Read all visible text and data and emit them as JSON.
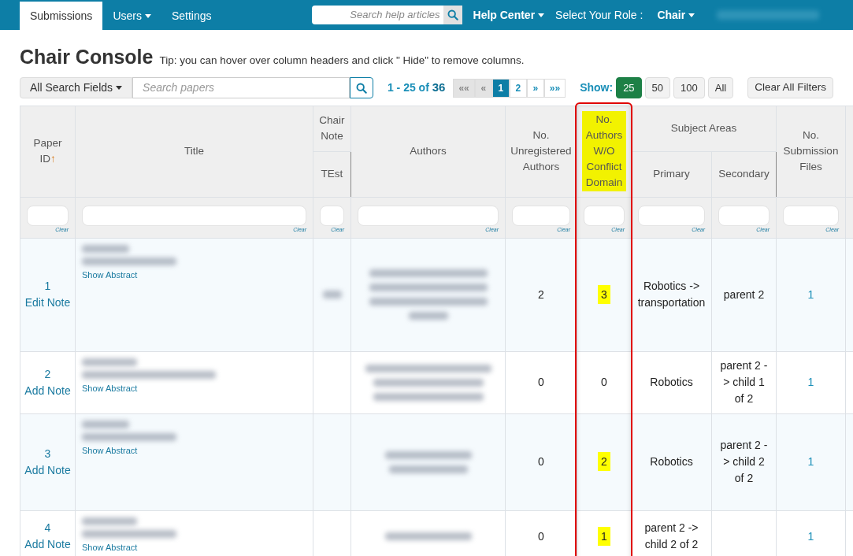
{
  "nav": {
    "tabs": [
      {
        "label": "Submissions",
        "selected": true,
        "dropdown": false
      },
      {
        "label": "Users",
        "selected": false,
        "dropdown": true
      },
      {
        "label": "Settings",
        "selected": false,
        "dropdown": false
      }
    ],
    "search": {
      "placeholder": "Search help articles"
    },
    "help": "Help Center",
    "role_label": "Select Your Role :",
    "role": "Chair"
  },
  "title": "Chair Console",
  "tip": "Tip: you can hover over column headers and click \" Hide\" to remove columns.",
  "toolbar": {
    "field_select": "All Search Fields",
    "search": {
      "placeholder": "Search papers"
    },
    "range": "1 - 25 of ",
    "total": "36",
    "pages": [
      {
        "label": "««",
        "selected": false
      },
      {
        "label": "«",
        "selected": false
      },
      {
        "label": "1",
        "selected": true
      },
      {
        "label": "2",
        "selected": false
      },
      {
        "label": "»",
        "selected": false
      },
      {
        "label": "»»",
        "selected": false
      }
    ],
    "show_label": "Show:",
    "show": [
      {
        "label": "25",
        "selected": true
      },
      {
        "label": "50",
        "selected": false
      },
      {
        "label": "100",
        "selected": false
      },
      {
        "label": "All",
        "selected": false
      }
    ],
    "clear_all": "Clear All Filters"
  },
  "table": {
    "filters": [
      {
        "clear": "Clear"
      },
      {
        "clear": "Clear"
      },
      {
        "clear": "Clear"
      },
      {
        "clear": "Clear"
      },
      {
        "clear": "Clear"
      },
      {
        "clear": "Clear"
      },
      {
        "clear": "Clear"
      },
      {
        "clear": "Clear"
      },
      {
        "clear": "Clear"
      }
    ],
    "columns": {
      "paper_id": "Paper ID",
      "sort_arrow": "↑",
      "title": "Title",
      "chair_note": "Chair Note",
      "chair_note_sub": "TEst",
      "authors": "Authors",
      "unregistered": "No. Unregistered Authors",
      "no_conflict": "No. Authors W/O Conflict Domain",
      "subject_areas": "Subject Areas",
      "primary": "Primary",
      "secondary": "Secondary",
      "files": "No. Submission Files"
    },
    "highlighted_header": true,
    "rows": [
      {
        "id": "1",
        "note_link": "Edit Note",
        "abstract": "Show Abstract",
        "unregistered": "2",
        "no_conflict": "3",
        "highlighted": true,
        "primary": "Robotics -> transportation",
        "secondary": "parent 2",
        "files": "1"
      },
      {
        "id": "2",
        "note_link": "Add Note",
        "abstract": "Show Abstract",
        "unregistered": "0",
        "no_conflict": "0",
        "highlighted": false,
        "primary": "Robotics",
        "secondary": "parent 2 -> child 1 of 2",
        "files": "1"
      },
      {
        "id": "3",
        "note_link": "Add Note",
        "abstract": "Show Abstract",
        "unregistered": "0",
        "no_conflict": "2",
        "highlighted": true,
        "primary": "Robotics",
        "secondary": "parent 2 -> child 2 of 2",
        "files": "1"
      },
      {
        "id": "4",
        "note_link": "Add Note",
        "abstract": "Show Abstract",
        "unregistered": "0",
        "no_conflict": "1",
        "highlighted": true,
        "primary": "parent 2 -> child 2 of 2",
        "secondary": "",
        "files": "1"
      }
    ]
  }
}
